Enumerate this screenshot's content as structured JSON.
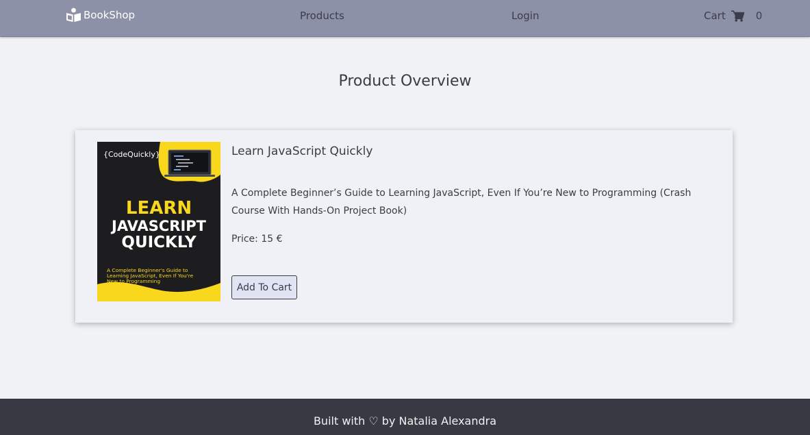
{
  "nav": {
    "brand": "BookShop",
    "products": "Products",
    "login": "Login",
    "cart": "Cart",
    "cart_count": "0"
  },
  "page": {
    "title": "Product Overview"
  },
  "product": {
    "name": "Learn JavaScript Quickly",
    "description": "A Complete Beginner’s Guide to Learning JavaScript, Even If You’re New to Programming (Crash Course With Hands-On Project Book)",
    "price": "Price: 15 €",
    "add_to_cart": "Add To Cart",
    "cover": {
      "publisher": "{CodeQuickly}",
      "line1": "LEARN",
      "line2": "JAVASCRIPT",
      "line3": "QUICKLY",
      "subtitle1": "A Complete Beginner's Guide to",
      "subtitle2": "Learning JavaScript, Even If You're",
      "subtitle3": "New to Programming"
    }
  },
  "footer": {
    "text": "Built with ♡ by Natalia Alexandra"
  },
  "colors": {
    "navbar": "#8c91a8",
    "background": "#f1f2f6",
    "footer": "#383943",
    "button": "#e1e4f3",
    "cover_dark": "#1d1d1f",
    "cover_yellow": "#f9d71c"
  },
  "icons": {
    "brand": "book-reader-icon",
    "cart": "shopping-cart-icon"
  }
}
